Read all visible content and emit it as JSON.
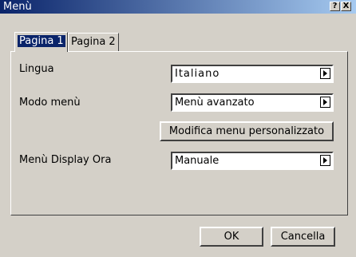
{
  "window": {
    "title": "Menù",
    "help_label": "?",
    "close_label": "X"
  },
  "tabs": [
    {
      "label": "Pagina 1",
      "active": true
    },
    {
      "label": "Pagina 2",
      "active": false
    }
  ],
  "settings": {
    "language": {
      "label": "Lingua",
      "value": "Italiano"
    },
    "menu_mode": {
      "label": "Modo menù",
      "value": "Menù avanzato"
    },
    "custom_menu_button": "Modifica menu personalizzato",
    "time_display": {
      "label": "Menù Display Ora",
      "value": "Manuale"
    }
  },
  "footer": {
    "ok_label": "OK",
    "cancel_label": "Cancella"
  },
  "colors": {
    "titlebar": "#0a246a",
    "face": "#d4d0c8"
  }
}
